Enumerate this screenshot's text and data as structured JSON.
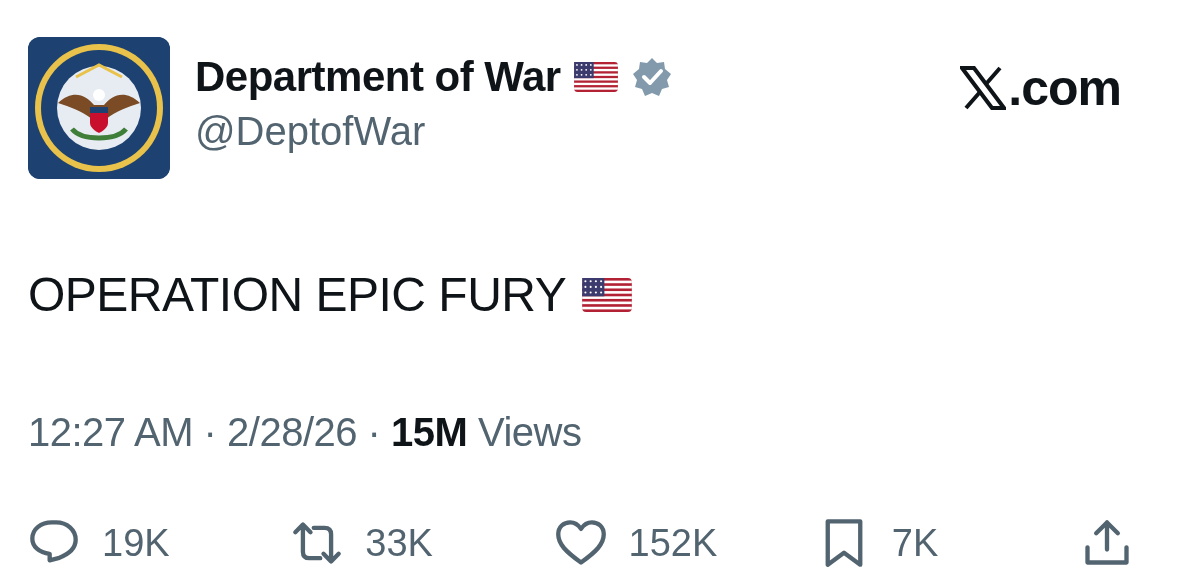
{
  "author": {
    "name": "Department of War",
    "handle": "@DeptofWar",
    "verified": true
  },
  "brand": {
    "suffix": ".com"
  },
  "post": {
    "text": "OPERATION EPIC FURY"
  },
  "meta": "12:27 AM · 2/28/26 · **15M** Views",
  "actions": [
    {
      "kind": "reply",
      "count": "19K"
    },
    {
      "kind": "repost",
      "count": "33K"
    },
    {
      "kind": "like",
      "count": "152K"
    },
    {
      "kind": "bookmark",
      "count": "7K"
    },
    {
      "kind": "share"
    }
  ]
}
